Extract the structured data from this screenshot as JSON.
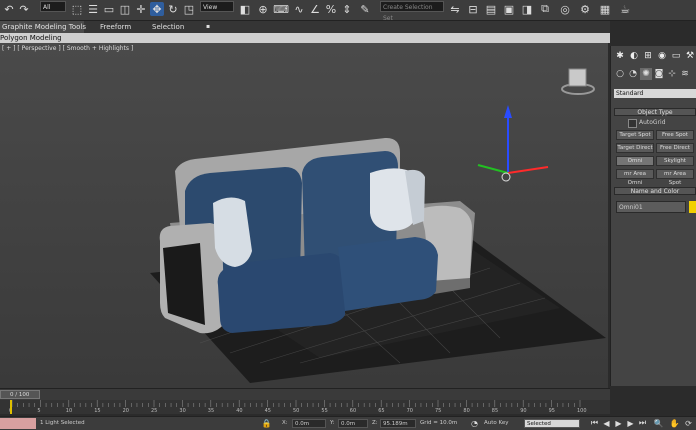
{
  "toolbar": {
    "selection_filter": "All",
    "reference_coord": "View",
    "named_selection_placeholder": "Create Selection Set"
  },
  "ribbon": {
    "tabs": [
      "Graphite Modeling Tools",
      "Freeform",
      "Selection"
    ],
    "active_panel": "Polygon Modeling"
  },
  "viewport": {
    "label": "[ + ] [ Perspective ] [ Smooth + Highlights ]"
  },
  "command_panel": {
    "category_dropdown": "Standard",
    "object_type_title": "Object Type",
    "autogrid_label": "AutoGrid",
    "buttons": [
      "Target Spot",
      "Free Spot",
      "Target Direct",
      "Free Direct",
      "Omni",
      "Skylight",
      "mr Area Omni",
      "mr Area Spot"
    ],
    "name_color_title": "Name and Color",
    "name_value": "Omni01",
    "object_color": "#f2cf00"
  },
  "timeline": {
    "frame_display": "0 / 100",
    "ticks": [
      "0",
      "5",
      "10",
      "15",
      "20",
      "25",
      "30",
      "35",
      "40",
      "45",
      "50",
      "55",
      "60",
      "65",
      "70",
      "75",
      "80",
      "85",
      "90",
      "95",
      "100"
    ]
  },
  "status": {
    "selection_text": "1 Light Selected",
    "x_label": "X:",
    "x_value": "0.0m",
    "y_label": "Y:",
    "y_value": "0.0m",
    "z_label": "Z:",
    "z_value": "95.189m",
    "grid_text": "Grid = 10.0m",
    "autokey_label": "Auto Key",
    "key_mode_value": "Selected"
  }
}
